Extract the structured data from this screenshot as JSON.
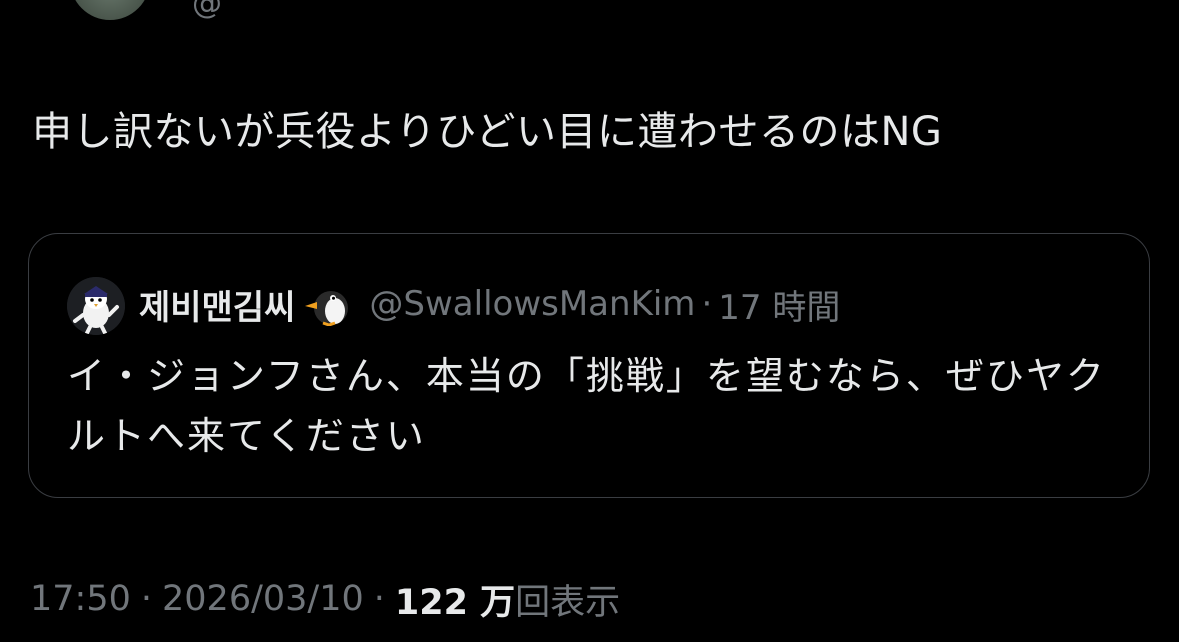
{
  "tweet": {
    "text": "申し訳ないが兵役よりひどい目に遭わせるのはNG",
    "top_handle_fragment": "@"
  },
  "quote": {
    "name": "제비맨김씨",
    "handle": "@SwallowsManKim",
    "separator": "·",
    "time": "17 時間",
    "text": "イ・ジョンフさん、本当の「挑戦」を望むなら、ぜひヤクルトへ来てください"
  },
  "meta": {
    "time": "17:50",
    "separator1": "·",
    "date": "2026/03/10",
    "separator2": "·",
    "views_count": "122 万",
    "views_label": "回表示"
  },
  "colors": {
    "background": "#000000",
    "text_primary": "#e7e9ea",
    "text_secondary": "#71767b",
    "card_border": "#3a3d42"
  },
  "icons": {
    "author_avatar": "author-avatar-icon",
    "quote_avatar": "mascot-avatar-icon",
    "name_emoji": "penguin-icon"
  }
}
